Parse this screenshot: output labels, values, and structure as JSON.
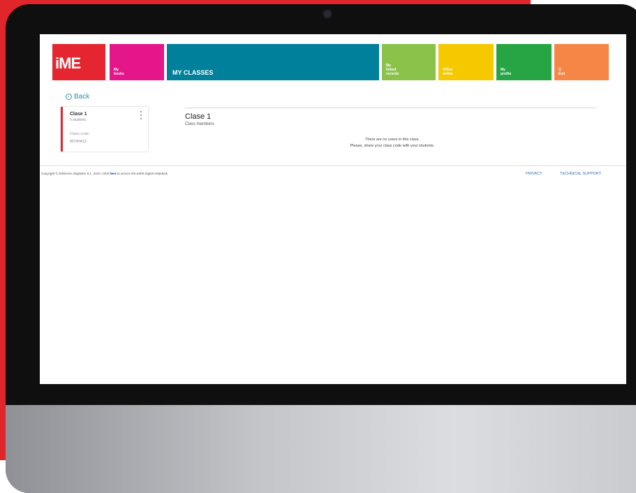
{
  "header": {
    "logo_text": "iME",
    "tiles": [
      {
        "label": "My\nbooks",
        "color": "#e5168a"
      },
      {
        "label": "My\nlinked\nrecords",
        "color": "#8bc34a"
      },
      {
        "label": "Office\nonline",
        "color": "#f5c800"
      },
      {
        "label": "My\nprofile",
        "color": "#27a544"
      },
      {
        "label": "⎋\nExit",
        "color": "#f58645"
      }
    ],
    "active_tab": {
      "label": "MY CLASSES",
      "color": "#00809a"
    }
  },
  "back_label": "Back",
  "class_card": {
    "title": "Clase 1",
    "students": "0 students",
    "code_label": "Class code",
    "code": "8070HA13"
  },
  "class_detail": {
    "title": "Clase 1",
    "subtitle": "Class members",
    "empty_line1": "There are no users in this class.",
    "empty_line2": "Please, share your class code with your students."
  },
  "footer": {
    "copyright_pre": "Copyright © Edelvives iDIgitales S.L. 2019. Click ",
    "copyright_link": "here",
    "copyright_post": " to access the EdMI Digital Helpdesk.",
    "privacy": "PRIVACY",
    "support": "TECHNICAL SUPPORT"
  }
}
